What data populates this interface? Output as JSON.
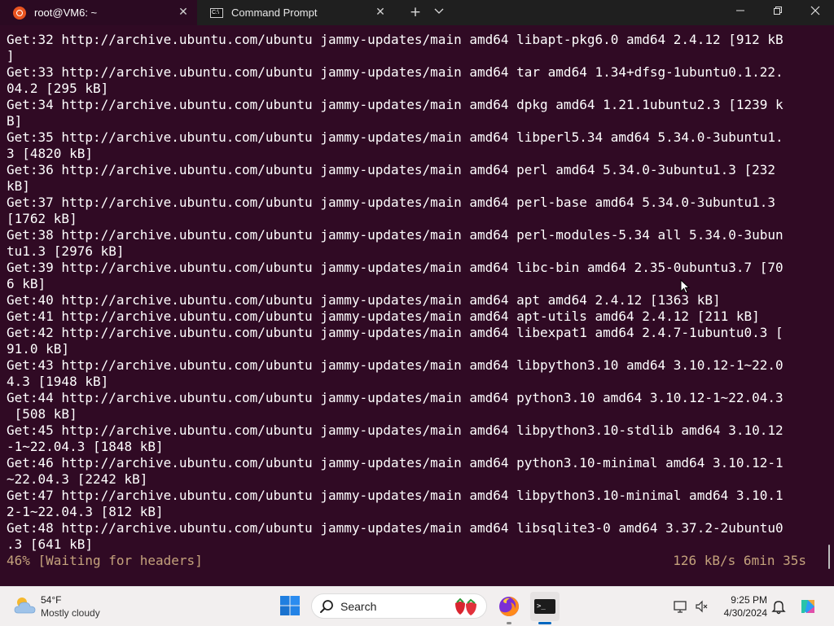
{
  "tabs": [
    {
      "title": "root@VM6: ~",
      "icon": "ubuntu-icon",
      "active": true
    },
    {
      "title": "Command Prompt",
      "icon": "command-prompt-icon",
      "active": false
    }
  ],
  "window_controls": {
    "new_tab": "+",
    "dropdown": "⌄",
    "minimize": "—",
    "maximize": "❐",
    "close": "✕"
  },
  "terminal": {
    "lines": [
      "Get:32 http://archive.ubuntu.com/ubuntu jammy-updates/main amd64 libapt-pkg6.0 amd64 2.4.12 [912 kB",
      "]",
      "Get:33 http://archive.ubuntu.com/ubuntu jammy-updates/main amd64 tar amd64 1.34+dfsg-1ubuntu0.1.22.",
      "04.2 [295 kB]",
      "Get:34 http://archive.ubuntu.com/ubuntu jammy-updates/main amd64 dpkg amd64 1.21.1ubuntu2.3 [1239 k",
      "B]",
      "Get:35 http://archive.ubuntu.com/ubuntu jammy-updates/main amd64 libperl5.34 amd64 5.34.0-3ubuntu1.",
      "3 [4820 kB]",
      "Get:36 http://archive.ubuntu.com/ubuntu jammy-updates/main amd64 perl amd64 5.34.0-3ubuntu1.3 [232",
      "kB]",
      "Get:37 http://archive.ubuntu.com/ubuntu jammy-updates/main amd64 perl-base amd64 5.34.0-3ubuntu1.3",
      "[1762 kB]",
      "Get:38 http://archive.ubuntu.com/ubuntu jammy-updates/main amd64 perl-modules-5.34 all 5.34.0-3ubun",
      "tu1.3 [2976 kB]",
      "Get:39 http://archive.ubuntu.com/ubuntu jammy-updates/main amd64 libc-bin amd64 2.35-0ubuntu3.7 [70",
      "6 kB]",
      "Get:40 http://archive.ubuntu.com/ubuntu jammy-updates/main amd64 apt amd64 2.4.12 [1363 kB]",
      "Get:41 http://archive.ubuntu.com/ubuntu jammy-updates/main amd64 apt-utils amd64 2.4.12 [211 kB]",
      "Get:42 http://archive.ubuntu.com/ubuntu jammy-updates/main amd64 libexpat1 amd64 2.4.7-1ubuntu0.3 [",
      "91.0 kB]",
      "Get:43 http://archive.ubuntu.com/ubuntu jammy-updates/main amd64 libpython3.10 amd64 3.10.12-1~22.0",
      "4.3 [1948 kB]",
      "Get:44 http://archive.ubuntu.com/ubuntu jammy-updates/main amd64 python3.10 amd64 3.10.12-1~22.04.3",
      " [508 kB]",
      "Get:45 http://archive.ubuntu.com/ubuntu jammy-updates/main amd64 libpython3.10-stdlib amd64 3.10.12",
      "-1~22.04.3 [1848 kB]",
      "Get:46 http://archive.ubuntu.com/ubuntu jammy-updates/main amd64 python3.10-minimal amd64 3.10.12-1",
      "~22.04.3 [2242 kB]",
      "Get:47 http://archive.ubuntu.com/ubuntu jammy-updates/main amd64 libpython3.10-minimal amd64 3.10.1",
      "2-1~22.04.3 [812 kB]",
      "Get:48 http://archive.ubuntu.com/ubuntu jammy-updates/main amd64 libsqlite3-0 amd64 3.37.2-2ubuntu0",
      ".3 [641 kB]"
    ],
    "status_left": "46% [Waiting for headers]",
    "status_right": "126 kB/s 6min 35s",
    "colors": {
      "background": "#300a24",
      "text": "#ffffff",
      "status": "#c4a27c"
    }
  },
  "taskbar": {
    "weather": {
      "temp": "54°F",
      "desc": "Mostly cloudy",
      "icon": "partly-cloudy-icon"
    },
    "search_label": "Search",
    "clock_time": "9:25 PM",
    "clock_date": "4/30/2024",
    "icons": [
      "windows-start-icon",
      "search-icon",
      "firefox-icon",
      "terminal-icon",
      "notification-bell-icon",
      "copilot-icon"
    ]
  }
}
